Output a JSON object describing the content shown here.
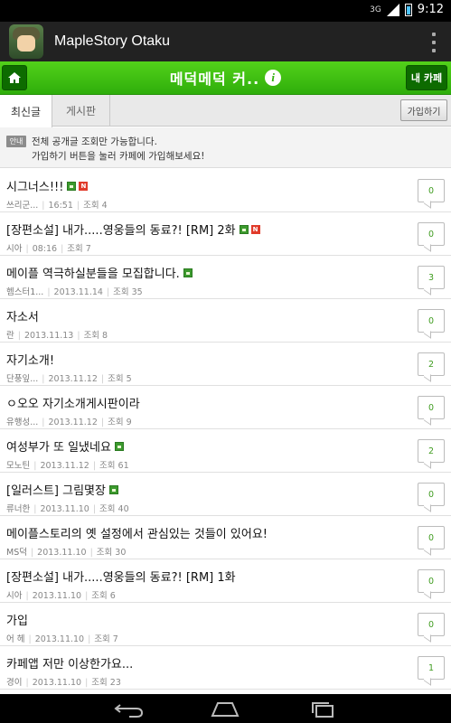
{
  "status_bar": {
    "network": "3G",
    "time": "9:12"
  },
  "app": {
    "title": "MapleStory Otaku",
    "icon": "maplestory-character-icon"
  },
  "cafe_header": {
    "title": "메덕메덕 커..",
    "my_cafe_label": "내 카페"
  },
  "tabs": [
    {
      "label": "최신글",
      "active": true
    },
    {
      "label": "게시판",
      "active": false
    }
  ],
  "join_button_label": "가입하기",
  "notice": {
    "badge": "안내",
    "line1": "전체 공개글 조회만 가능합니다.",
    "line2": "가입하기 버튼을 눌러 카페에 가입해보세요!"
  },
  "posts": [
    {
      "title": "시그너스!!!",
      "author": "쓰리군...",
      "date": "16:51",
      "views": "조회 4",
      "comments": "0",
      "has_image": true,
      "is_new": true
    },
    {
      "title": "[장편소설] 내가.....영웅들의 동료?! [RM] 2화",
      "author": "시아",
      "date": "08:16",
      "views": "조회 7",
      "comments": "0",
      "has_image": true,
      "is_new": true
    },
    {
      "title": "메이플 역극하실분들을 모집합니다.",
      "author": "헴스터1...",
      "date": "2013.11.14",
      "views": "조회 35",
      "comments": "3",
      "has_image": true,
      "is_new": false
    },
    {
      "title": "자소서",
      "author": "란",
      "date": "2013.11.13",
      "views": "조회 8",
      "comments": "0",
      "has_image": false,
      "is_new": false
    },
    {
      "title": "자기소개!",
      "author": "단풍잎...",
      "date": "2013.11.12",
      "views": "조회 5",
      "comments": "2",
      "has_image": false,
      "is_new": false
    },
    {
      "title": "ㅇ오오 자기소개게시판이라",
      "author": "유행성...",
      "date": "2013.11.12",
      "views": "조회 9",
      "comments": "0",
      "has_image": false,
      "is_new": false
    },
    {
      "title": "여성부가 또 일냈네요",
      "author": "모노틴",
      "date": "2013.11.12",
      "views": "조회 61",
      "comments": "2",
      "has_image": true,
      "is_new": false
    },
    {
      "title": "[일러스트] 그림몇장",
      "author": "류너한",
      "date": "2013.11.10",
      "views": "조회 40",
      "comments": "0",
      "has_image": true,
      "is_new": false
    },
    {
      "title": "메이플스토리의 옛 설정에서 관심있는 것들이 있어요!",
      "author": "MS덕",
      "date": "2013.11.10",
      "views": "조회 30",
      "comments": "0",
      "has_image": false,
      "is_new": false
    },
    {
      "title": "[장편소설] 내가.....영웅들의 동료?! [RM] 1화",
      "author": "시아",
      "date": "2013.11.10",
      "views": "조회 6",
      "comments": "0",
      "has_image": false,
      "is_new": false
    },
    {
      "title": "가입",
      "author": "어 헤",
      "date": "2013.11.10",
      "views": "조회 7",
      "comments": "0",
      "has_image": false,
      "is_new": false
    },
    {
      "title": "카페앱 저만 이상한가요...",
      "author": "경이",
      "date": "2013.11.10",
      "views": "조회 23",
      "comments": "1",
      "has_image": false,
      "is_new": false
    }
  ],
  "nav": {
    "back": "back-icon",
    "home": "home-icon",
    "recent": "recent-apps-icon"
  }
}
